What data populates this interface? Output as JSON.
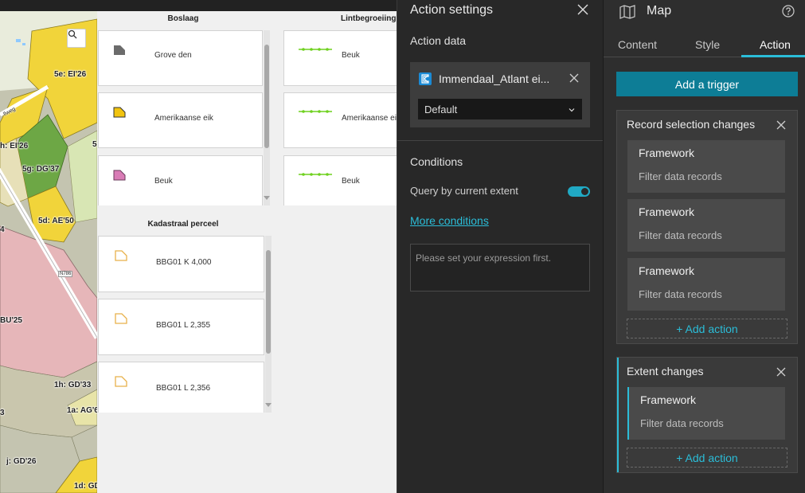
{
  "map": {
    "labels": [
      "5e: EI'26",
      "5g: DG'37",
      "h: EI'26",
      "5d: AE'50",
      "BU'25",
      "1h: GD'33",
      "1a: AG'6",
      "j: GD'26",
      "1d: GD",
      "5",
      "4",
      "3"
    ],
    "road_label": "N786",
    "street_label": "llweg",
    "search_icon": "search-icon"
  },
  "legend": {
    "groups": [
      {
        "title": "Boslaag",
        "items": [
          "Grove den",
          "Amerikaanse eik",
          "Beuk"
        ]
      },
      {
        "title": "Lintbegroeiing",
        "items": [
          "Beuk",
          "Amerikaanse eik",
          "Beuk"
        ]
      },
      {
        "title": "Kadastraal perceel",
        "items": [
          "BBG01 K 4,000",
          "BBG01 L 2,355",
          "BBG01 L 2,356"
        ]
      }
    ],
    "swatch_colors": {
      "grove_den": "#6b6b6b",
      "amerikaanse_eik": "#f2c40f",
      "beuk": "#d97cb6",
      "lint": "#6fd11f",
      "perceel": "#e8b14a"
    }
  },
  "action_settings": {
    "title": "Action settings",
    "action_data_label": "Action data",
    "datasource_name": "Immendaal_Atlant ei...",
    "datasource_view": "Default",
    "conditions_label": "Conditions",
    "query_extent_label": "Query by current extent",
    "query_extent_on": true,
    "more_conditions": "More conditions",
    "expression_placeholder": "Please set your expression first."
  },
  "map_settings": {
    "title": "Map",
    "tabs": [
      "Content",
      "Style",
      "Action"
    ],
    "active_tab": "Action",
    "add_trigger": "Add a trigger",
    "triggers": [
      {
        "title": "Record selection changes",
        "actions": [
          {
            "title": "Framework",
            "sub": "Filter data records"
          },
          {
            "title": "Framework",
            "sub": "Filter data records"
          },
          {
            "title": "Framework",
            "sub": "Filter data records"
          }
        ],
        "add_action": "+ Add action"
      },
      {
        "title": "Extent changes",
        "actions": [
          {
            "title": "Framework",
            "sub": "Filter data records"
          }
        ],
        "add_action": "+ Add action"
      }
    ],
    "accent_color": "#2bbdd8",
    "button_color": "#0d7d96"
  }
}
